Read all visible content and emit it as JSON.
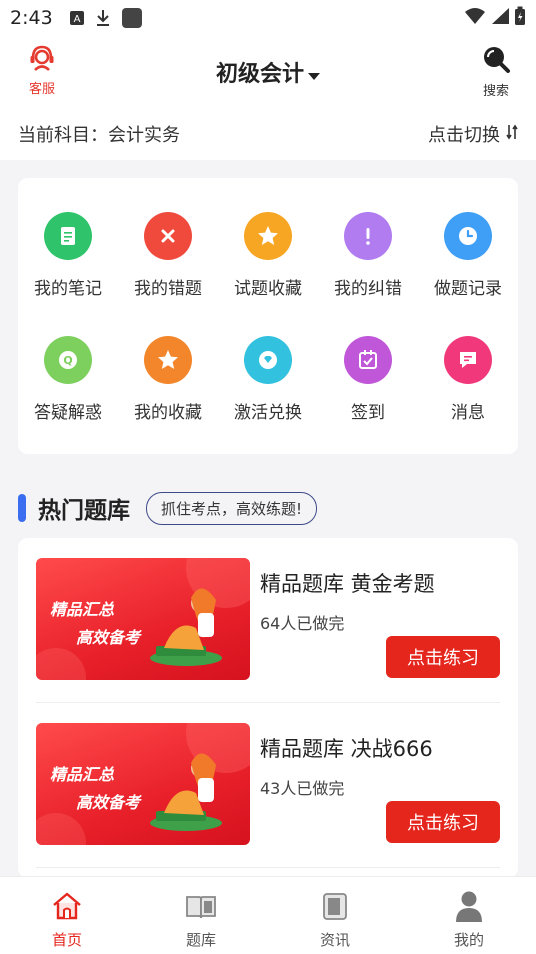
{
  "status_bar": {
    "time": "2:43"
  },
  "header": {
    "service_label": "客服",
    "title": "初级会计",
    "search_label": "搜索"
  },
  "subject": {
    "current_label": "当前科目：会计实务",
    "switch_label": "点击切换"
  },
  "features": [
    {
      "label": "我的笔记",
      "icon": "note-icon",
      "color": "#2fc36b"
    },
    {
      "label": "我的错题",
      "icon": "wrong-icon",
      "color": "#f04a3c"
    },
    {
      "label": "试题收藏",
      "icon": "star-icon",
      "color": "#f7a623"
    },
    {
      "label": "我的纠错",
      "icon": "exclamation-icon",
      "color": "#b07cf0"
    },
    {
      "label": "做题记录",
      "icon": "clock-icon",
      "color": "#3f9ef5"
    },
    {
      "label": "答疑解惑",
      "icon": "qa-icon",
      "color": "#7dd05e"
    },
    {
      "label": "我的收藏",
      "icon": "star-icon",
      "color": "#f3862a"
    },
    {
      "label": "激活兑换",
      "icon": "diamond-icon",
      "color": "#33c1e0"
    },
    {
      "label": "签到",
      "icon": "calendar-icon",
      "color": "#c057d8"
    },
    {
      "label": "消息",
      "icon": "message-icon",
      "color": "#f0387a"
    }
  ],
  "hot": {
    "title": "热门题库",
    "tag": "抓住考点，高效练题!"
  },
  "banks": [
    {
      "banner_line1": "精品汇总",
      "banner_line2": "高效备考",
      "title": "精品题库 黄金考题",
      "count": "64人已做完",
      "button": "点击练习"
    },
    {
      "banner_line1": "精品汇总",
      "banner_line2": "高效备考",
      "title": "精品题库 决战666",
      "count": "43人已做完",
      "button": "点击练习"
    }
  ],
  "nav": [
    {
      "label": "首页",
      "icon": "home-icon",
      "active": true
    },
    {
      "label": "题库",
      "icon": "book-icon",
      "active": false
    },
    {
      "label": "资讯",
      "icon": "news-icon",
      "active": false
    },
    {
      "label": "我的",
      "icon": "user-icon",
      "active": false
    }
  ],
  "colors": {
    "accent": "#e5261c",
    "section_bar": "#3a6df0"
  }
}
